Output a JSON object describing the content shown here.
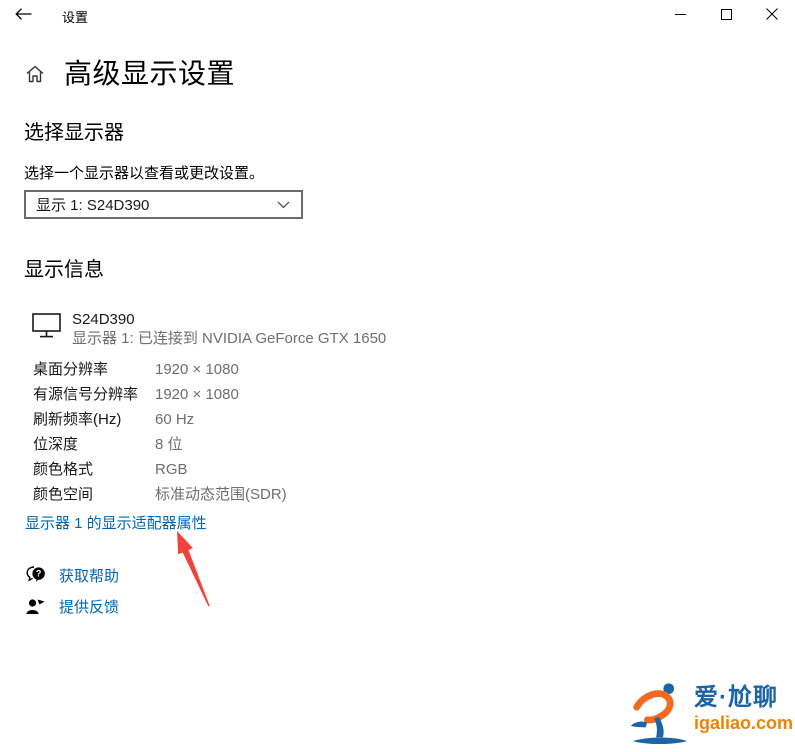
{
  "window": {
    "title": "设置",
    "controls": {
      "minimize_icon": "minimize",
      "maximize_icon": "maximize",
      "close_icon": "close"
    },
    "back_icon": "arrow-left"
  },
  "header": {
    "home_icon": "home",
    "title": "高级显示设置"
  },
  "choose_display": {
    "heading": "选择显示器",
    "description": "选择一个显示器以查看或更改设置。",
    "selected_display": "显示 1: S24D390",
    "chevron_icon": "chevron-down"
  },
  "display_info": {
    "heading": "显示信息",
    "monitor_icon": "monitor",
    "monitor": {
      "name": "S24D390",
      "connection": "显示器 1: 已连接到 NVIDIA GeForce GTX 1650"
    },
    "properties": [
      {
        "label": "桌面分辨率",
        "value": "1920 × 1080"
      },
      {
        "label": "有源信号分辨率",
        "value": "1920 × 1080"
      },
      {
        "label": "刷新频率(Hz)",
        "value": "60 Hz"
      },
      {
        "label": "位深度",
        "value": "8 位"
      },
      {
        "label": "颜色格式",
        "value": "RGB"
      },
      {
        "label": "颜色空间",
        "value": "标准动态范围(SDR)"
      }
    ],
    "adapter_link": "显示器 1 的显示适配器属性"
  },
  "footer_links": [
    {
      "icon": "speech-bubble-question",
      "label": "获取帮助"
    },
    {
      "icon": "person-feedback",
      "label": "提供反馈"
    }
  ],
  "annotation": {
    "type": "red-arrow",
    "points_to": "adapter_link"
  },
  "watermark": {
    "runner_icon": "running-figure",
    "brand": "爱·尬聊",
    "site": "igaliao.com"
  },
  "colors": {
    "link_blue": "#0066b4",
    "value_gray": "#6e6e6e",
    "arrow_red": "#f0433a",
    "logo_blue": "#1b64a8",
    "logo_orange": "#f08300"
  }
}
